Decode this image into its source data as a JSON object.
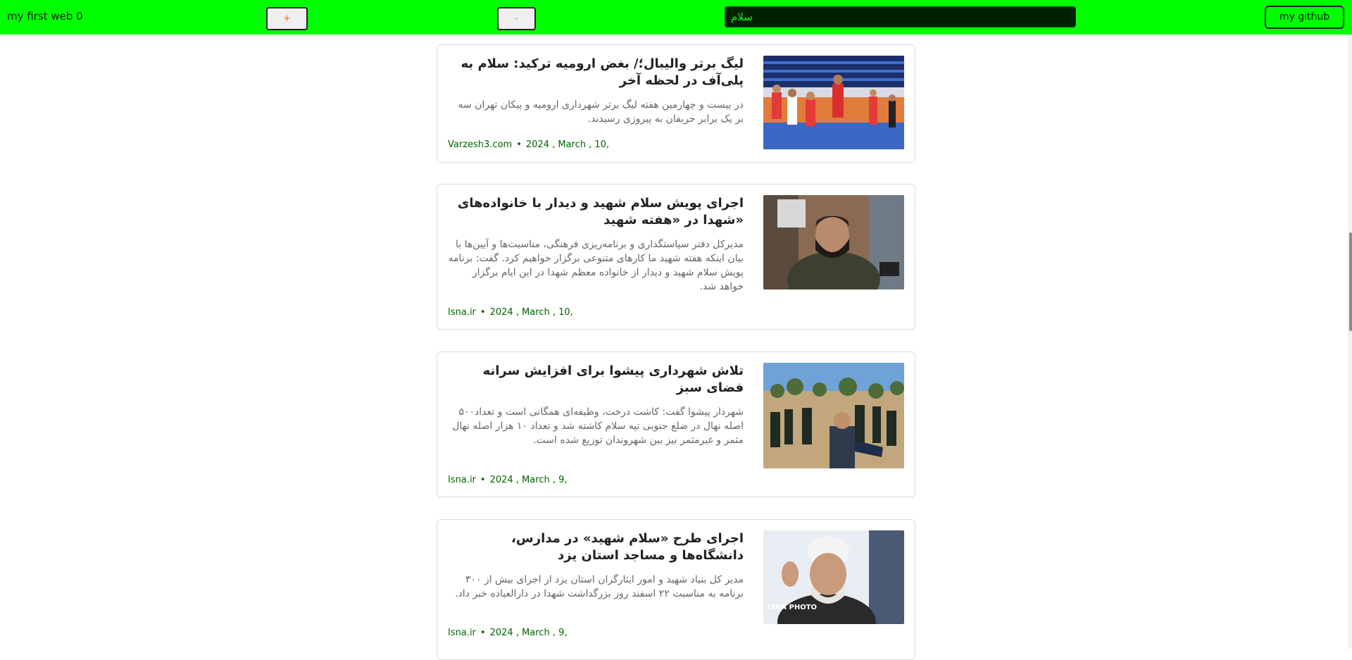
{
  "header": {
    "brand": "my first web 0",
    "plus_label": "+",
    "minus_label": "-",
    "search_value": "سلام",
    "github_label": "my github"
  },
  "articles": [
    {
      "title": "لیگ برتر والیبال؛/ بغض ارومیه ترکید: سلام به پلی‌آف در لحظه آخر",
      "description": "در بیست و چهارمین هفته لیگ برتر شهرداری ارومیه و پیکان تهران سه بر یک برابر حریفان به پیروزی رسیدند.",
      "source": "Varzesh3.com",
      "date": "2024 , March , 10,"
    },
    {
      "title": "اجرای پویش سلام شهید و دیدار با خانواده‌های «شهدا در «هفته شهید",
      "description": "مدیرکل دفتر سیاستگذاری و برنامه‌ریزی فرهنگی، مناسبت‌ها و آیین‌ها با بیان اینکه هفته شهید ما کارهای متنوعی برگزار خواهیم کرد. گفت: برنامه پویش سلام شهید و دیدار از خانواده معظم شهدا در این ایام برگزار خواهد شد.",
      "source": "Isna.ir",
      "date": "2024 , March , 10,"
    },
    {
      "title": "تلاش شهرداری پیشوا برای افزایش سرانه فضای سبز",
      "description": "شهردار پیشوا گفت: کاشت درخت، وظیفه‌ای همگانی است و تعداد۵۰۰ اصله نهال در ضلع جنوبی تپه سلام کاشته شد و تعداد ۱۰ هزار اصله نهال مثمر و غیرمثمر نیز بین شهروندان توزیع شده است.",
      "source": "Isna.ir",
      "date": "2024 , March , 9,"
    },
    {
      "title": "اجرای طرح «سلام شهید» در مدارس، دانشگاه‌ها و مساجد استان یزد",
      "description": "مدیر کل بنیاد شهید و امور ایثارگران استان یزد از اجرای بیش از ۳۰۰ برنامه به مناسبت ۲۲ اسفند روز بزرگداشت شهدا در دارالعباده خبر داد.",
      "source": "Isna.ir",
      "date": "2024 , March , 9,"
    }
  ],
  "image_watermark": "ISNA PHOTO",
  "colors": {
    "header_bg": "#00ff00",
    "search_bg": "#002200",
    "search_text": "#00ff00",
    "meta_text": "#006400",
    "plus_text": "#ff6600"
  }
}
